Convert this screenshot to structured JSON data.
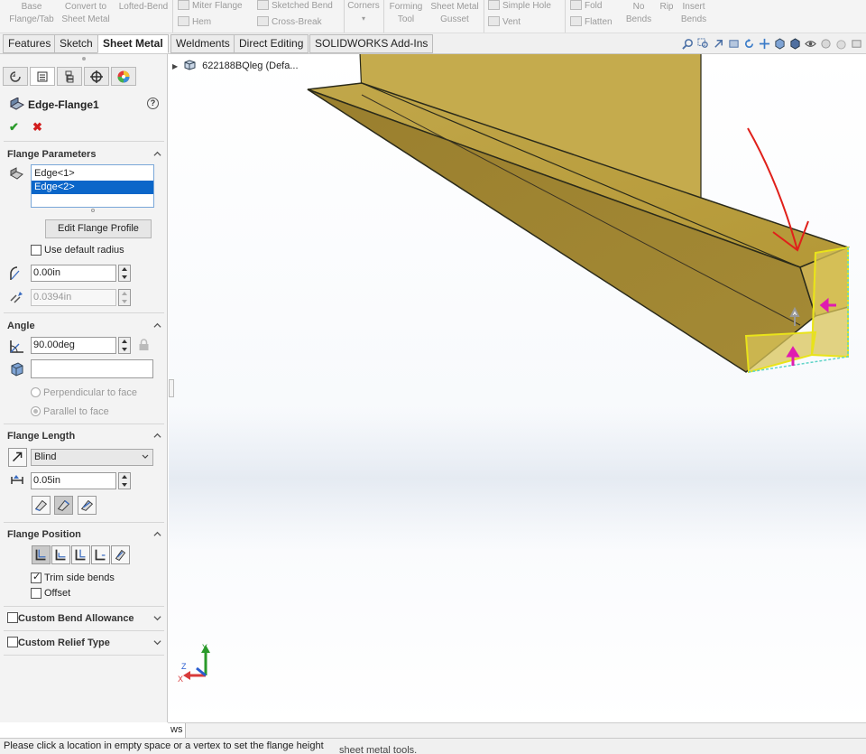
{
  "ribbon": {
    "base_flange": "Base\nFlange/Tab",
    "convert": "Convert to\nSheet Metal",
    "lofted": "Lofted-Bend",
    "miter": "Miter Flange",
    "hem": "Hem",
    "sketched_bend": "Sketched Bend",
    "cross_break": "Cross-Break",
    "corners": "Corners",
    "forming_tool": "Forming\nTool",
    "gusset": "Sheet Metal\nGusset",
    "simple_hole": "Simple Hole",
    "vent": "Vent",
    "fold": "Fold",
    "flatten": "Flatten",
    "no_bends": "No\nBends",
    "rip": "Rip",
    "insert_bends": "Insert\nBends"
  },
  "tabs": [
    "Features",
    "Sketch",
    "Sheet Metal",
    "Weldments",
    "Direct Editing",
    "SOLIDWORKS Add-Ins"
  ],
  "active_tab": "Sheet Metal",
  "tree": {
    "part_name": "622188BQleg  (Defa..."
  },
  "feature": {
    "title": "Edge-Flange1",
    "ok": "✔",
    "cancel": "✖"
  },
  "flange_parameters": {
    "header": "Flange Parameters",
    "edges": [
      "Edge<1>",
      "Edge<2>"
    ],
    "selected_edge": "Edge<2>",
    "edit_profile": "Edit Flange Profile",
    "use_default_radius": "Use default radius",
    "use_default_radius_checked": false,
    "radius": "0.00in",
    "thickness": "0.0394in"
  },
  "angle": {
    "header": "Angle",
    "value": "90.00deg",
    "face": "",
    "perpendicular": "Perpendicular to face",
    "parallel": "Parallel to face",
    "selected": "parallel"
  },
  "flange_length": {
    "header": "Flange Length",
    "type": "Blind",
    "value": "0.05in"
  },
  "flange_position": {
    "header": "Flange Position",
    "trim_side_bends": "Trim side bends",
    "trim_checked": true,
    "offset": "Offset",
    "offset_checked": false
  },
  "custom_bend_allowance": {
    "label": "Custom Bend Allowance",
    "checked": false
  },
  "custom_relief_type": {
    "label": "Custom Relief Type",
    "checked": false
  },
  "bottom_tab": "ws",
  "status": "Please click a location in empty space or a vertex to set the flange height",
  "status_ghost": "sheet metal tools.",
  "colors": {
    "part_face": "#b99e3c",
    "part_dark": "#8f7427",
    "highlight": "#e9e31a",
    "arrow_pink": "#e01bb0",
    "annotation_red": "#e0201a",
    "selection_blue": "#0b66c9"
  },
  "icons": [
    "feature-manager-icon",
    "property-manager-icon",
    "configuration-manager-icon",
    "dimxpert-icon",
    "display-manager-icon",
    "edge-flange-icon",
    "radius-icon",
    "thickness-icon",
    "angle-icon",
    "face-icon",
    "flip-direction-icon",
    "length-icon",
    "triad-icon"
  ]
}
